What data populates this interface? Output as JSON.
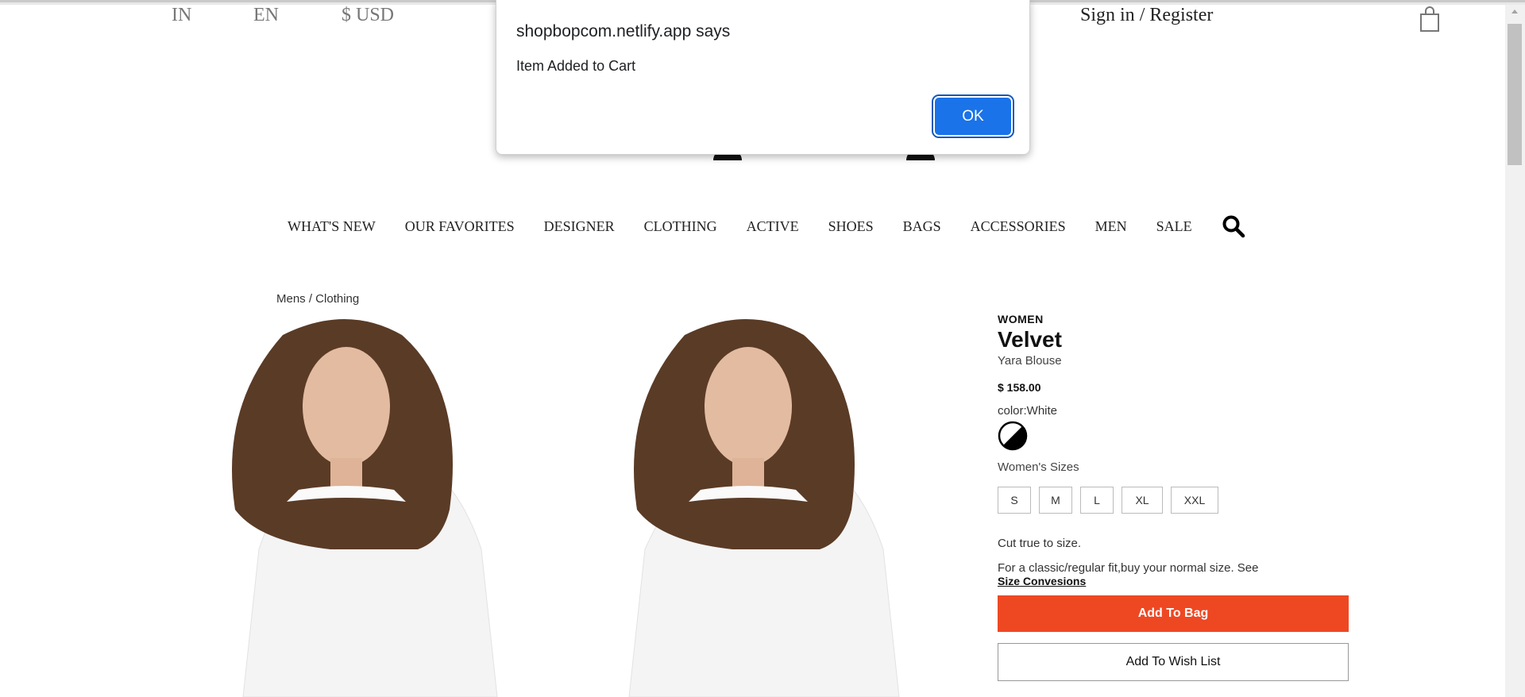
{
  "topbar": {
    "country": "IN",
    "language": "EN",
    "currency": "$ USD",
    "sign_in": "Sign in",
    "separator": "/",
    "register": "Register",
    "cart_icon": "shopping-bag-icon"
  },
  "nav": {
    "items": [
      "WHAT'S NEW",
      "OUR FAVORITES",
      "DESIGNER",
      "CLOTHING",
      "ACTIVE",
      "SHOES",
      "BAGS",
      "ACCESSORIES",
      "MEN",
      "SALE"
    ],
    "search_icon": "search-icon"
  },
  "breadcrumb": "Mens / Clothing",
  "product": {
    "category": "WOMEN",
    "brand": "Velvet",
    "name": "Yara Blouse",
    "price": "$ 158.00",
    "color_label": "color:White",
    "sizes_label": "Women's Sizes",
    "sizes": [
      "S",
      "M",
      "L",
      "XL",
      "XXL"
    ],
    "fit_note": "Cut true to size.",
    "fit_advice": "For a classic/regular fit,buy your normal size. See",
    "size_link": "Size Convesions",
    "add_to_bag": "Add To Bag",
    "add_to_wishlist": "Add To Wish List",
    "accent_color": "#ee4823"
  },
  "dialog": {
    "title": "shopbopcom.netlify.app says",
    "message": "Item Added to Cart",
    "ok": "OK",
    "button_color": "#1a73e8"
  }
}
